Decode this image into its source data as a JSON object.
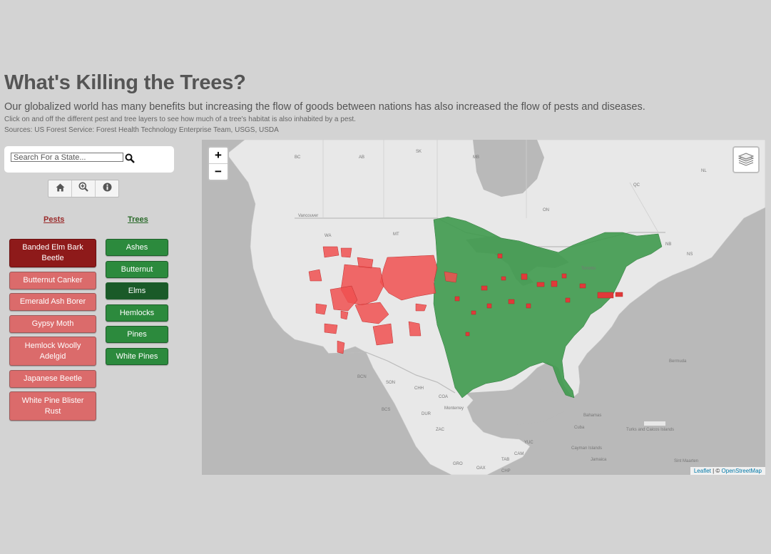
{
  "header": {
    "title": "What's Killing the Trees?",
    "subtitle": "Our globalized world has many benefits but increasing the flow of goods between nations has also increased the flow of pests and diseases.",
    "instructions": "Click on and off the different pest and tree layers to see how much of a tree's habitat is also inhabited by a pest.",
    "sources": "Sources: US Forest Service: Forest Health Technology Enterprise Team, USGS, USDA"
  },
  "search": {
    "placeholder": "Search For a State...",
    "value": "",
    "icon": "search-icon"
  },
  "toolbar": {
    "buttons": [
      {
        "icon": "home-icon"
      },
      {
        "icon": "zoom-extent-icon"
      },
      {
        "icon": "info-icon"
      }
    ]
  },
  "pests": {
    "header": "Pests",
    "items": [
      {
        "label": "Banded Elm Bark Beetle",
        "active": true
      },
      {
        "label": "Butternut Canker",
        "active": false
      },
      {
        "label": "Emerald Ash Borer",
        "active": false
      },
      {
        "label": "Gypsy Moth",
        "active": false
      },
      {
        "label": "Hemlock Woolly Adelgid",
        "active": false
      },
      {
        "label": "Japanese Beetle",
        "active": false
      },
      {
        "label": "White Pine Blister Rust",
        "active": false
      }
    ]
  },
  "trees": {
    "header": "Trees",
    "items": [
      {
        "label": "Ashes",
        "active": false
      },
      {
        "label": "Butternut",
        "active": false
      },
      {
        "label": "Elms",
        "active": true
      },
      {
        "label": "Hemlocks",
        "active": false
      },
      {
        "label": "Pines",
        "active": false
      },
      {
        "label": "White Pines",
        "active": false
      }
    ]
  },
  "map": {
    "zoom_in": "+",
    "zoom_out": "−",
    "layers_icon": "layers-icon",
    "attribution": {
      "leaflet": "Leaflet",
      "separator": " | © ",
      "osm": "OpenStreetMap"
    },
    "labels": {
      "bc": "BC",
      "ab": "AB",
      "sk": "SK",
      "mb": "MB",
      "on": "ON",
      "qc": "QC",
      "nl": "NL",
      "nb": "NB",
      "ns": "NS",
      "vancouver": "Vancouver",
      "wa": "WA",
      "mt": "MT",
      "toronto": "Toronto",
      "bermuda": "Bermuda",
      "son": "SON",
      "chh": "CHH",
      "coa": "COA",
      "bahamas": "Bahamas",
      "cuba": "Cuba",
      "jamaica": "Jamaica",
      "turks": "Turks and Caicos Islands",
      "cayman": "Cayman Islands",
      "sint_maarten": "Sint Maarten",
      "monterrey": "Monterrey",
      "yuc": "YUC",
      "cam": "CAM",
      "tab": "TAB",
      "oax": "OAX",
      "chp": "CHP",
      "gro": "GRO",
      "dur": "DUR",
      "zac": "ZAC",
      "bcs": "BCS",
      "bcn": "BCN"
    },
    "colors": {
      "pest_layer": "#f05050",
      "tree_layer": "#3f9a4e",
      "land": "#e9e9e9",
      "water": "#b8b8b8"
    }
  }
}
